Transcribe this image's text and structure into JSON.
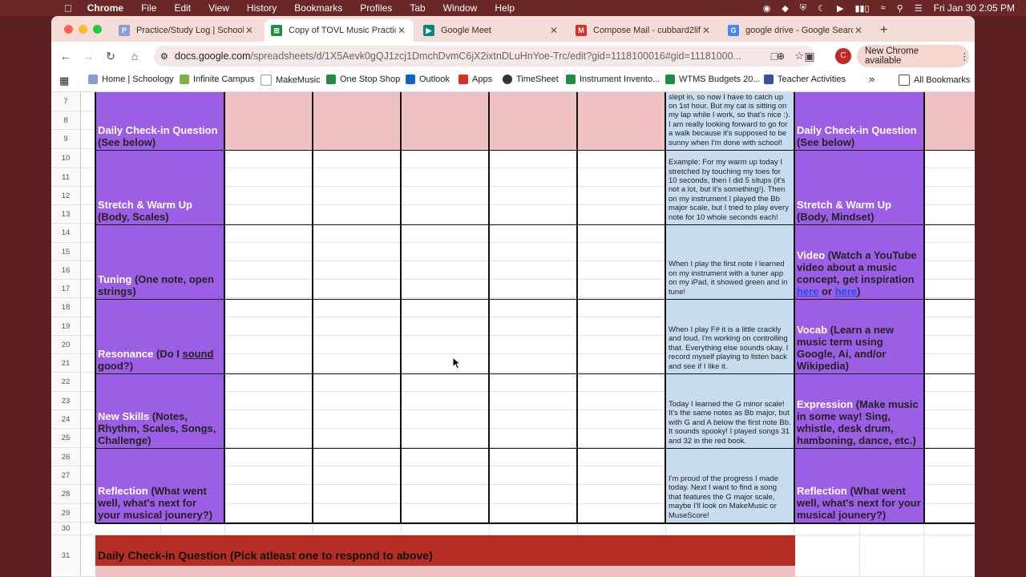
{
  "menubar": {
    "app": "Chrome",
    "items": [
      "File",
      "Edit",
      "View",
      "History",
      "Bookmarks",
      "Profiles",
      "Tab",
      "Window",
      "Help"
    ],
    "clock": "Fri Jan 30  2:05 PM"
  },
  "tabs": [
    {
      "label": "Practice/Study Log | Schoology",
      "icon_color": "#8a9bd9",
      "active": false
    },
    {
      "label": "Copy of TOVL Music Practice",
      "icon_color": "#1e8e3e",
      "active": true
    },
    {
      "label": "Google Meet",
      "icon_color": "#00897b",
      "active": false
    },
    {
      "label": "Compose Mail - cubbard2life",
      "icon_color": "#d93025",
      "active": false
    },
    {
      "label": "google drive - Google Search",
      "icon_color": "#4285f4",
      "active": false
    }
  ],
  "toolbar": {
    "url_host": "docs.google.com",
    "url_path": "/spreadsheets/d/1X5Aevk0gQJ1zcj1DmchDvmC6jX2ixtnDLuHnYoe-Trc/edit?gid=1118100016#gid=11181000...",
    "new_chrome": "New Chrome available",
    "profile_initial": "C"
  },
  "bookmarks": [
    {
      "label": "Home | Schoology",
      "icon_color": "#8a9bd9"
    },
    {
      "label": "Infinite Campus",
      "icon_color": "#7cb342"
    },
    {
      "label": "MakeMusic",
      "icon_color": "#ffffff"
    },
    {
      "label": "One Stop Shop",
      "icon_color": "#1e8e3e"
    },
    {
      "label": "Outlook",
      "icon_color": "#0a64c8"
    },
    {
      "label": "Apps",
      "icon_color": "#d93025"
    },
    {
      "label": "TimeSheet",
      "icon_color": "#333333"
    },
    {
      "label": "Instrument Invento...",
      "icon_color": "#1e8e3e"
    },
    {
      "label": "WTMS Budgets 20...",
      "icon_color": "#1e8e3e"
    },
    {
      "label": "Teacher Activities",
      "icon_color": "#3a4fa0"
    }
  ],
  "all_bookmarks": "All Bookmarks",
  "row_numbers": [
    "7",
    "8",
    "9",
    "10",
    "11",
    "12",
    "13",
    "14",
    "15",
    "16",
    "17",
    "18",
    "19",
    "20",
    "21",
    "22",
    "23",
    "24",
    "25",
    "26",
    "27",
    "28",
    "29",
    "30",
    "31"
  ],
  "left_labels": [
    {
      "bold": "Daily Check-in Question",
      "rest": " (See below)"
    },
    {
      "bold": "Stretch & Warm Up",
      "rest": " (Body, Scales)"
    },
    {
      "bold": "Tuning",
      "rest": " (One note, open strings)"
    },
    {
      "bold": "Resonance",
      "rest": " (Do I ",
      "link": "sound",
      "after": " good?)"
    },
    {
      "bold": "New Skills",
      "rest": " (Notes, Rhythm, Scales, Songs, Challenge)"
    },
    {
      "bold": "Reflection",
      "rest": " (What went well, what's next for your musical jounery?)"
    }
  ],
  "examples": [
    "slept in, so now I have to catch up on 1st hour. But my cat is sitting on my lap while I work, so that's nice :). I am really looking forward to go for a walk because it's supposed to be sunny when I'm done with school!",
    "Example: For my warm up today I stretched by touching my toes for 10 seconds, then I did 5 situps (it's not a lot, but it's something!). Then on my instrument I played the Bb major scale, but I tried to play every note for 10 whole seconds each!",
    "When I play the first note I learned on my instrument with a tuner app on my iPad, it showed green and in tune!",
    "When I play F# it is a little crackly and loud, I'm working on controlling that. Everything else sounds okay. I record myself playing to listen back and see if I like it.",
    "Today I learned the G minor scale! It's the same notes as Bb major, but with G and A below the first note Bb. It sounds spooky! I played songs 31 and 32 in the red book.",
    "I'm proud of the progress I made today. Next I want to find a song that features the G major scale, maybe I'll look on MakeMusic or MuseScore!"
  ],
  "right_labels": {
    "r0": {
      "bold": "Daily Check-in Question",
      "rest": " (See below)"
    },
    "r1": {
      "bold": "Stretch & Warm Up",
      "rest": " (Body, Mindset)"
    },
    "r2": {
      "bold": "Video",
      "rest": " (Watch a YouTube video about a music concept, get inspiration ",
      "link1": "here",
      "mid": " or ",
      "link2": "here",
      "end": ")"
    },
    "r3": {
      "bold": "Vocab",
      "rest": " (Learn a new music term using Google, Ai, and/or Wikipedia)"
    },
    "r4": {
      "bold": "Expression",
      "rest": " (Make music in some way! Sing, whistle, desk drum, hamboning, dance, etc.)"
    },
    "r5": {
      "bold": "Reflection",
      "rest": " (What went well, what's next for your musical jounery?)"
    }
  },
  "footer_heading": "Daily Check-in Question (Pick atleast one to respond to above)",
  "colors": {
    "purple": "#9d5ee6",
    "pink": "#efc1c3",
    "blue": "#c7dcef",
    "red": "#b62e23"
  }
}
